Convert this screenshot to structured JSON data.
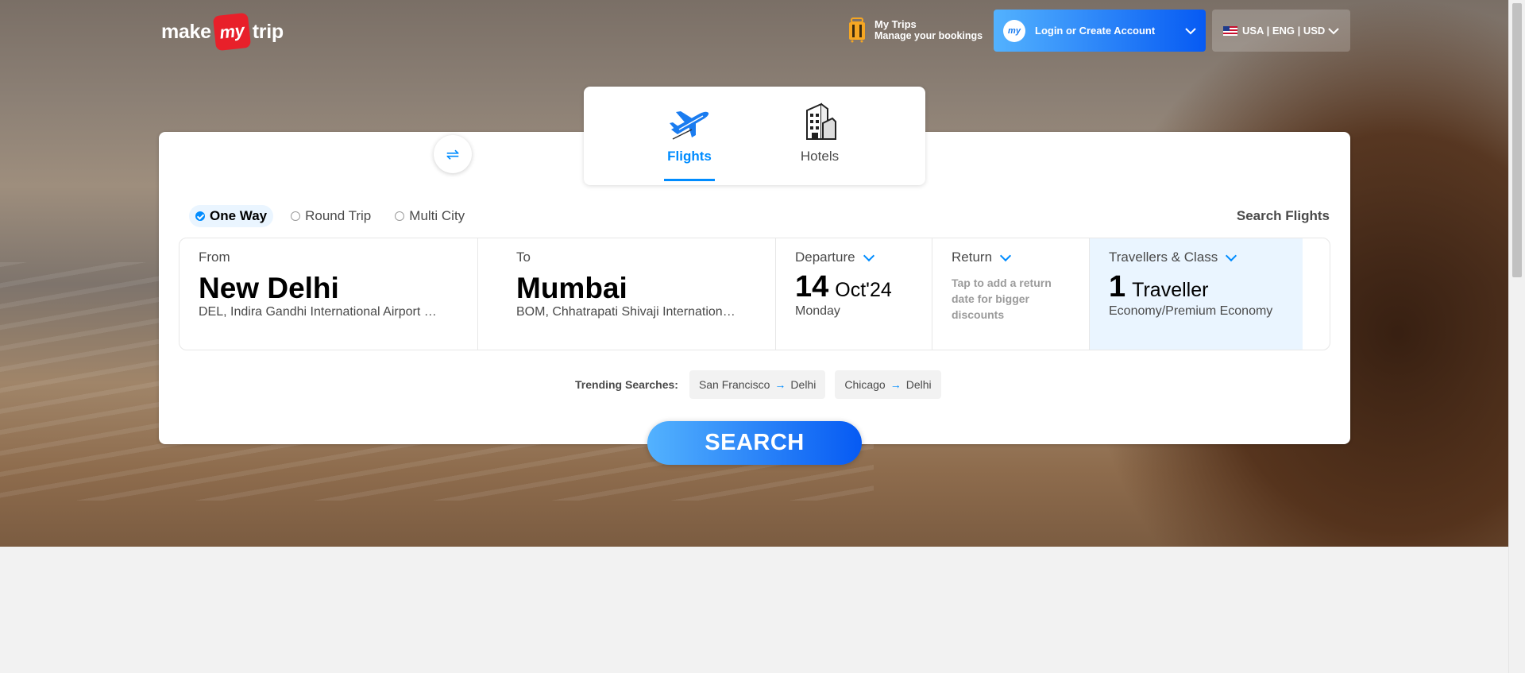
{
  "header": {
    "logo": {
      "pre": "make",
      "my": "my",
      "post": "trip"
    },
    "my_trips": {
      "title": "My Trips",
      "subtitle": "Manage your bookings"
    },
    "login": {
      "avatar": "my",
      "label": "Login or Create Account"
    },
    "locale": {
      "label": "USA | ENG | USD",
      "flag": "us-flag-icon"
    }
  },
  "tabs": [
    {
      "label": "Flights",
      "icon": "plane-icon",
      "active": true
    },
    {
      "label": "Hotels",
      "icon": "hotel-building-icon",
      "active": false
    }
  ],
  "trip_types": [
    {
      "label": "One Way",
      "selected": true
    },
    {
      "label": "Round Trip",
      "selected": false
    },
    {
      "label": "Multi City",
      "selected": false
    }
  ],
  "search_flights_label": "Search Flights",
  "fields": {
    "from": {
      "caption": "From",
      "city": "New Delhi",
      "airport": "DEL, Indira Gandhi International Airport …"
    },
    "to": {
      "caption": "To",
      "city": "Mumbai",
      "airport": "BOM, Chhatrapati Shivaji Internation…"
    },
    "departure": {
      "caption": "Departure",
      "day": "14",
      "month_year": "Oct'24",
      "weekday": "Monday"
    },
    "return": {
      "caption": "Return",
      "hint": "Tap to add a return date for bigger discounts"
    },
    "travellers": {
      "caption": "Travellers & Class",
      "count": "1",
      "unit": "Traveller",
      "class": "Economy/Premium Economy"
    }
  },
  "swap_icon": "swap-arrows-icon",
  "trending": {
    "label": "Trending Searches:",
    "items": [
      {
        "from": "San Francisco",
        "to": "Delhi"
      },
      {
        "from": "Chicago",
        "to": "Delhi"
      }
    ]
  },
  "search_button": "SEARCH",
  "colors": {
    "accent": "#008cff",
    "gradient_start": "#53b2fe",
    "gradient_end": "#065af3",
    "logo_red": "#e8202a",
    "traveller_bg": "#eaf5ff"
  }
}
